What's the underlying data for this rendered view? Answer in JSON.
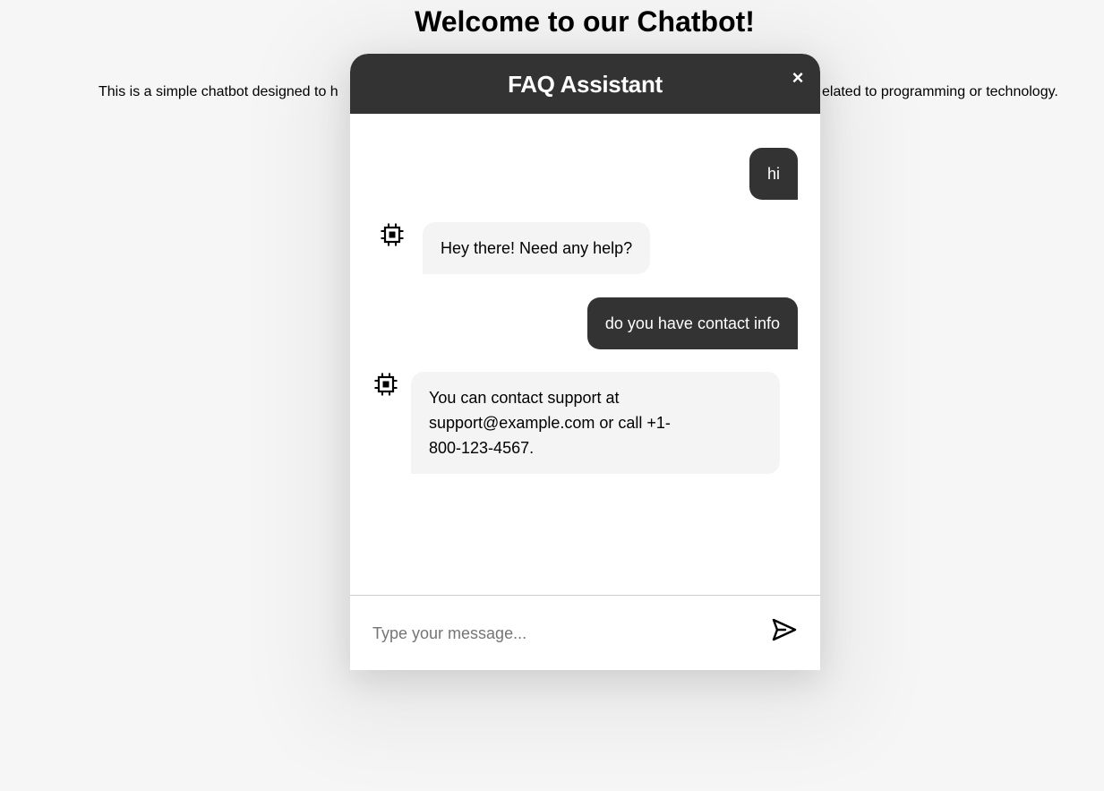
{
  "page": {
    "title": "Welcome to our Chatbot!",
    "description_left": "This is a simple chatbot designed to h",
    "description_right": "elated to programming or technology."
  },
  "chat": {
    "title": "FAQ Assistant",
    "close_label": "×",
    "messages": [
      {
        "sender": "user",
        "text": "hi"
      },
      {
        "sender": "bot",
        "text": "Hey there! Need any help?"
      },
      {
        "sender": "user",
        "text": "do you have contact info"
      },
      {
        "sender": "bot",
        "text": "You can contact support at support@example.com or call +1-800-123-4567."
      }
    ],
    "input": {
      "placeholder": "Type your message...",
      "value": ""
    },
    "icons": {
      "bot": "chip-icon",
      "send": "send-icon",
      "close": "close-icon"
    },
    "colors": {
      "header": "#333333",
      "user_bubble": "#333333",
      "bot_bubble": "#f4f4f4",
      "page_background": "#f6f6f6"
    }
  }
}
